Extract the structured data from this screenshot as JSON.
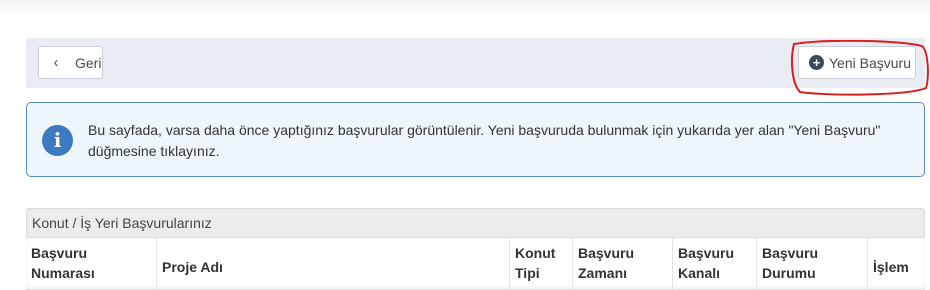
{
  "toolbar": {
    "back_label": "Geri",
    "new_label": "Yeni Başvuru"
  },
  "alert": {
    "message": "Bu sayfada, varsa daha önce yaptığınız başvurular görüntülenir. Yeni başvuruda bulunmak için yukarıda yer alan \"Yeni Başvuru\" düğmesine tıklayınız."
  },
  "table": {
    "title": "Konut / İş Yeri Başvurularınız",
    "columns": [
      {
        "line1": "Başvuru",
        "line2": "Numarası"
      },
      {
        "line1": "",
        "line2": "Proje Adı"
      },
      {
        "line1": "Konut",
        "line2": "Tipi"
      },
      {
        "line1": "Başvuru",
        "line2": "Zamanı"
      },
      {
        "line1": "Başvuru",
        "line2": "Kanalı"
      },
      {
        "line1": "Başvuru",
        "line2": "Durumu"
      },
      {
        "line1": "",
        "line2": "İşlem"
      }
    ]
  },
  "colors": {
    "annotation": "#d81e1e",
    "info_blue": "#3d7ac0",
    "alert_border": "#5b8fc4"
  }
}
